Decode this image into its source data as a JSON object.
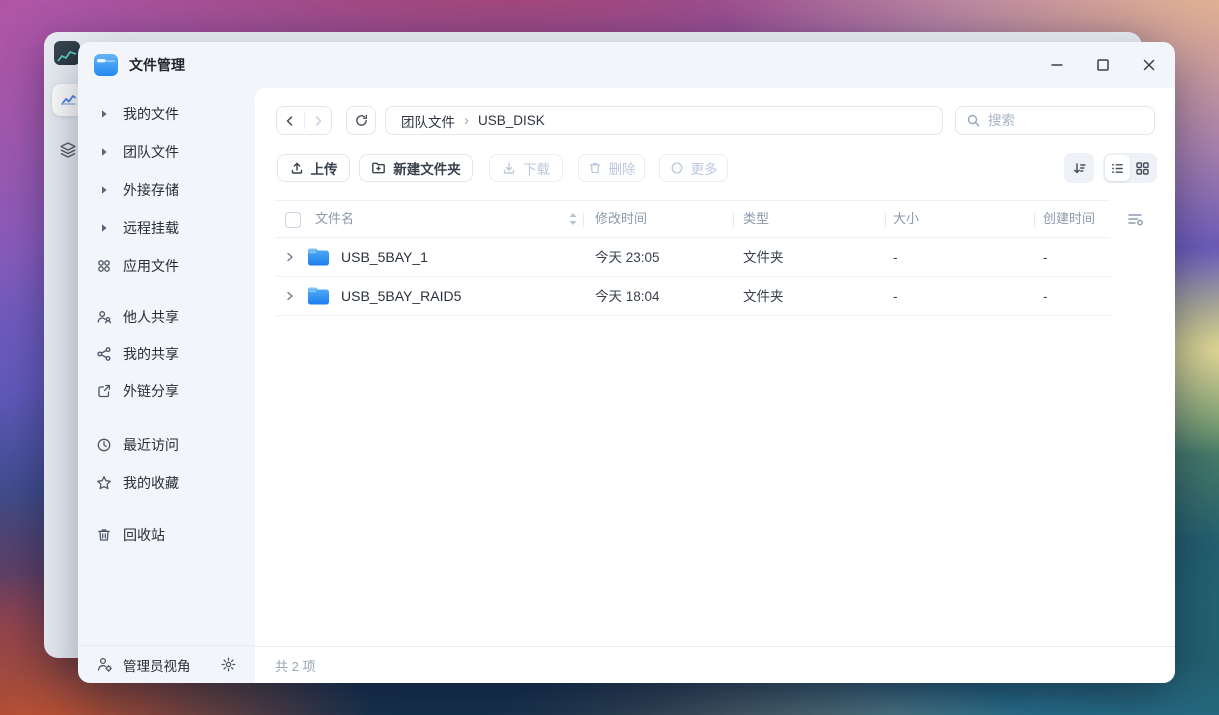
{
  "window": {
    "title": "文件管理"
  },
  "sidebar": {
    "tree": [
      {
        "label": "我的文件"
      },
      {
        "label": "团队文件"
      },
      {
        "label": "外接存储"
      },
      {
        "label": "远程挂载"
      },
      {
        "label": "应用文件"
      }
    ],
    "shares": [
      {
        "label": "他人共享"
      },
      {
        "label": "我的共享"
      },
      {
        "label": "外链分享"
      }
    ],
    "recents": [
      {
        "label": "最近访问"
      },
      {
        "label": "我的收藏"
      }
    ],
    "trash": {
      "label": "回收站"
    },
    "footer": {
      "label": "管理员视角"
    }
  },
  "nav": {
    "breadcrumb": {
      "root": "团队文件",
      "separator": "›",
      "current": "USB_DISK"
    },
    "search_placeholder": "搜索"
  },
  "toolbar": {
    "upload": "上传",
    "new_folder": "新建文件夹",
    "download": "下载",
    "delete": "删除",
    "more": "更多"
  },
  "table": {
    "columns": {
      "name": "文件名",
      "modified": "修改时间",
      "type": "类型",
      "size": "大小",
      "created": "创建时间"
    },
    "rows": [
      {
        "name": "USB_5BAY_1",
        "modified": "今天 23:05",
        "type": "文件夹",
        "size": "-",
        "created": "-"
      },
      {
        "name": "USB_5BAY_RAID5",
        "modified": "今天 18:04",
        "type": "文件夹",
        "size": "-",
        "created": "-"
      }
    ]
  },
  "status": {
    "count": "共 2 项"
  },
  "colors": {
    "accent": "#2f80ed",
    "folder_top": "#55acf6",
    "folder_bottom": "#1b7dee"
  }
}
